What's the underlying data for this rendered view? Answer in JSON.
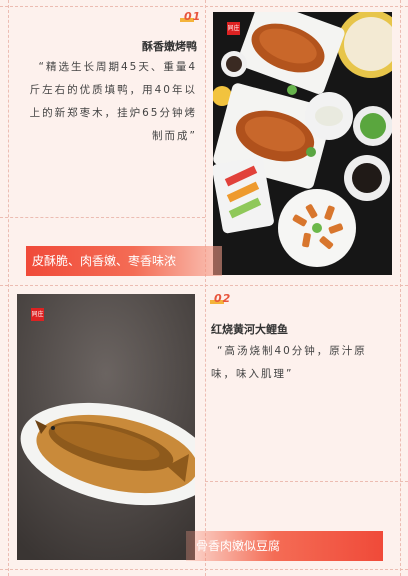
{
  "dish1": {
    "number": "01",
    "title": "酥香嫩烤鸭",
    "description_lines": [
      "“精选生长周期45天、重量4",
      "斤左右的优质填鸭，用40年以",
      "上的新郑枣木，挂炉65分钟烤",
      "制而成”"
    ],
    "tag": "皮酥脆、肉香嫩、枣香味浓",
    "logo_text": "同庄"
  },
  "dish2": {
    "number": "02",
    "title": "红烧黄河大鲤鱼",
    "description_lines": [
      "“高汤烧制40分钟，原汁原",
      "味，味入肌理”"
    ],
    "tag": "骨香肉嫩似豆腐",
    "logo_text": "同庄"
  },
  "colors": {
    "accent": "#f04a39",
    "number_bar": "#f4b33a",
    "background": "#fdf1ed"
  }
}
